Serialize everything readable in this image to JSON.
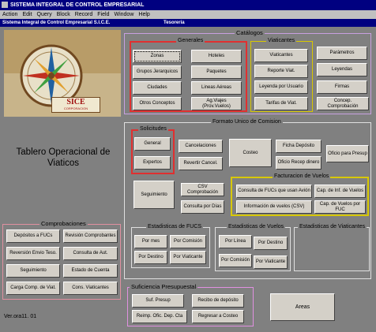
{
  "window": {
    "title": "SISTEMA INTEGRAL DE CONTROL EMPRESARIAL"
  },
  "menu": [
    "Action",
    "Edit",
    "Query",
    "Block",
    "Record",
    "Field",
    "Window",
    "Help"
  ],
  "banner": {
    "app": "Sistema Integral de Control Empresarial  S.I.C.E.",
    "form": "Tesoreria"
  },
  "logo": {
    "text": "SICE",
    "subtext": "CORPORACION"
  },
  "dashboard_title": "Tablero Operacional de Viaticos",
  "version": "Ver.ora11. 01",
  "catalogos": {
    "title": "Catálogos",
    "generales": {
      "title": "Generales",
      "buttons": [
        "Zonas",
        "Hoteles",
        "Grupos Jerarquicos",
        "Paquetes",
        "Ciudades",
        "Lineas Aéreas",
        "Otros Conceptos",
        "Ag.Viajes (Prov.Vuelos)"
      ]
    },
    "viaticantes": {
      "title": "Viaticantes",
      "buttons": [
        "Viaticantes",
        "Reporte Viat.",
        "Leyenda por Usuario",
        "Tarifas de Viat."
      ]
    },
    "extra": [
      "Parámetros",
      "Leyendas",
      "Firmas",
      "Concep. Comprobación"
    ]
  },
  "formato": {
    "title": "Formato Unico de Comision",
    "solicitudes": {
      "title": "Solicitudes",
      "buttons": [
        "General",
        "Expertos"
      ]
    },
    "buttons": [
      "Cancelaciones",
      "Revertir Cancel.",
      "Costeo",
      "Ficha Depósito",
      "Oficio Recep dinero",
      "Oficio para Presup",
      "Seguimiento",
      "CSV Comprobación",
      "Consulta por Días"
    ],
    "facturacion": {
      "title": "Facturacion de Vuelos",
      "buttons": [
        "Consulta de FUCs que usan Avión",
        "Cap. de Inf. de Vuelos",
        "Información de vuelos (CSV)",
        "Cap. de Vuelos por FUC"
      ]
    },
    "est_fucs": {
      "title": "Estadisticas de FUCS",
      "buttons": [
        "Por mes",
        "Por Comisión",
        "Por Destino",
        "Por Viaticante"
      ]
    },
    "est_vuelos": {
      "title": "Estadisticas de Vuelos",
      "buttons": [
        "Por Línea",
        "Por Destino",
        "Por Comisión",
        "Por Viaticante"
      ]
    },
    "est_viaticantes": {
      "title": "Estadisticas de Viaticantes"
    }
  },
  "comprobaciones": {
    "title": "Comprobaciones",
    "buttons": [
      "Depósitos a FUCs",
      "Revisión Comprobantes",
      "Reversión Envio Teso.",
      "Consulta de Aut.",
      "Seguimiento",
      "Estado de Cuenta",
      "Carga Comp. de Viat.",
      "Cons. Viaticantes"
    ]
  },
  "suficiencia": {
    "title": "Suficiencia Presupuestal",
    "buttons": [
      "Suf. Presup",
      "Recibo de depósito",
      "Reimp. Ofic. Dep. Cta",
      "Regresar a Costeo"
    ]
  },
  "areas_button": "Areas",
  "colors": {
    "titlebar": "#000080",
    "background": "#808080",
    "button": "#d4d0c8",
    "catalog_border": "#c8a0e0",
    "red_border": "#e03030",
    "yellow_border": "#d8c800",
    "pink_border": "#e090e0"
  }
}
